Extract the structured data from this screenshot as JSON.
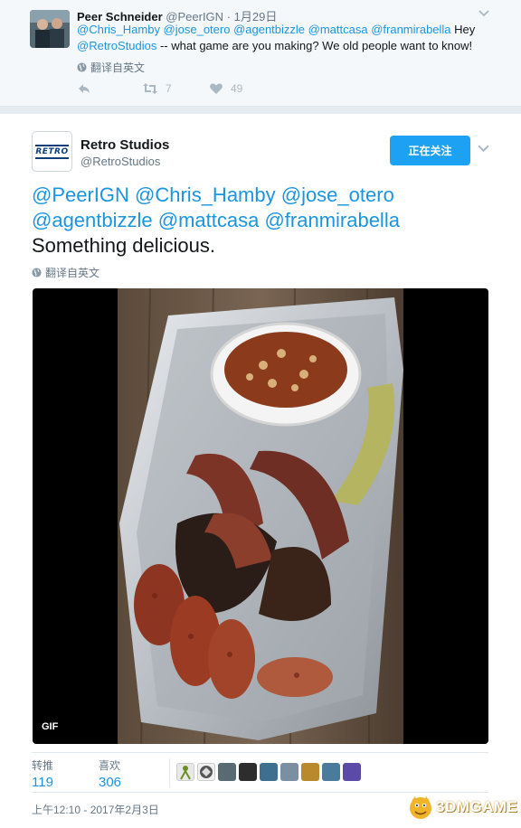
{
  "parent_tweet": {
    "name": "Peer Schneider",
    "handle": "@PeerIGN",
    "separator": "·",
    "time": "1月29日",
    "text_mentions": "@Chris_Hamby @jose_otero @agentbizzle @mattcasa @franmirabella",
    "text_hey": " Hey ",
    "text_mention2": "@RetroStudios",
    "text_rest": " -- what game are you making? We old people want to know!",
    "translate_label": "翻译自英文",
    "retweet_count": "7",
    "like_count": "49"
  },
  "main_tweet": {
    "name": "Retro Studios",
    "handle": "@RetroStudios",
    "logo_text": "RETRO",
    "follow_label": "正在关注",
    "text_mentions": "@PeerIGN @Chris_Hamby @jose_otero @agentbizzle @mattcasa @franmirabella",
    "text_body": "Something delicious.",
    "translate_label": "翻译自英文",
    "media_badge": "GIF",
    "retweets_label": "转推",
    "retweets_count": "119",
    "likes_label": "喜欢",
    "likes_count": "306",
    "timestamp": "上午12:10 - 2017年2月3日"
  },
  "watermark": {
    "text": "3DMGAME"
  },
  "colors": {
    "link": "#1b95e0",
    "follow_button": "#1da1f2",
    "muted": "#657786"
  },
  "icons": [
    "chevron-down-icon",
    "globe-icon",
    "reply-icon",
    "retweet-icon",
    "heart-icon"
  ]
}
